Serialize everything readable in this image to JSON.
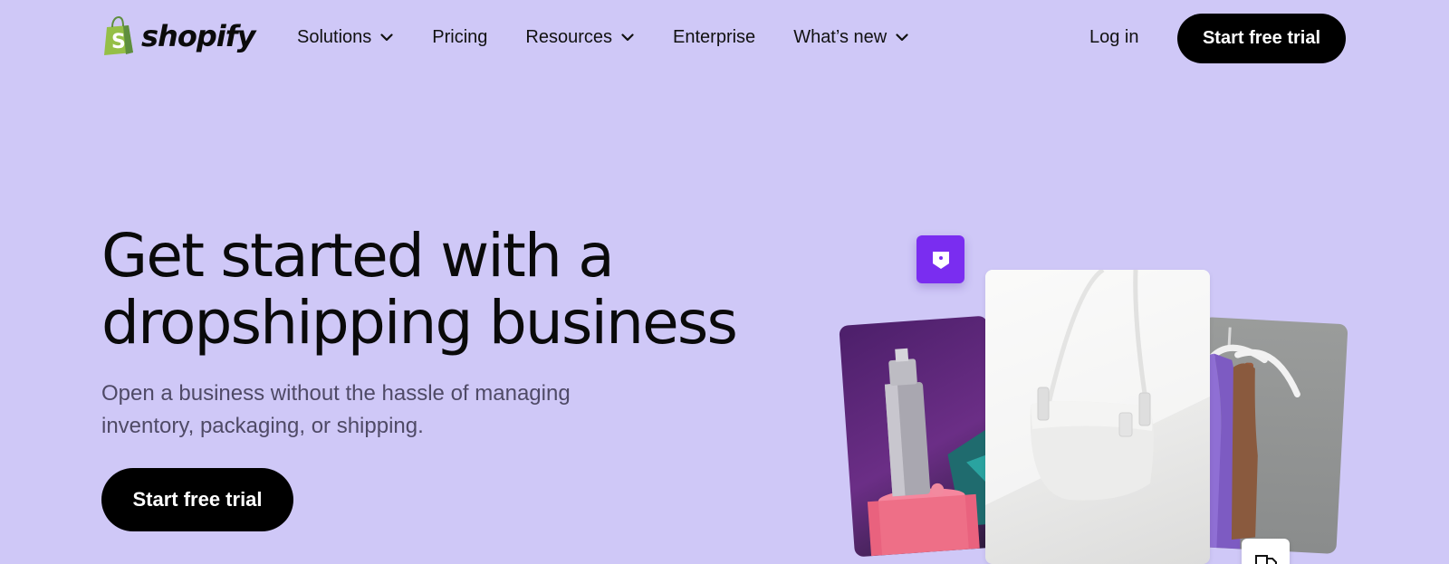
{
  "header": {
    "logo_text": "shopify",
    "nav": [
      {
        "label": "Solutions",
        "has_dropdown": true
      },
      {
        "label": "Pricing",
        "has_dropdown": false
      },
      {
        "label": "Resources",
        "has_dropdown": true
      },
      {
        "label": "Enterprise",
        "has_dropdown": false
      },
      {
        "label": "What’s new",
        "has_dropdown": true
      }
    ],
    "login_label": "Log in",
    "cta_label": "Start free trial"
  },
  "hero": {
    "title_line1": "Get started with a",
    "title_line2": "dropshipping business",
    "subtitle_line1": "Open a business without the hassle of managing",
    "subtitle_line2": "inventory, packaging, or shipping.",
    "cta_label": "Start free trial"
  },
  "collage": {
    "images": [
      {
        "name": "product-image-skincare-bottle"
      },
      {
        "name": "product-image-white-handbag"
      },
      {
        "name": "product-image-tank-tops-on-hangers"
      }
    ],
    "badges": [
      {
        "icon": "tag-icon"
      },
      {
        "icon": "truck-icon"
      }
    ]
  },
  "colors": {
    "background": "#cfc8f7",
    "button": "#000000",
    "button_text": "#ffffff",
    "logo_green": "#95bf47",
    "tag_badge": "#7a2df0"
  }
}
